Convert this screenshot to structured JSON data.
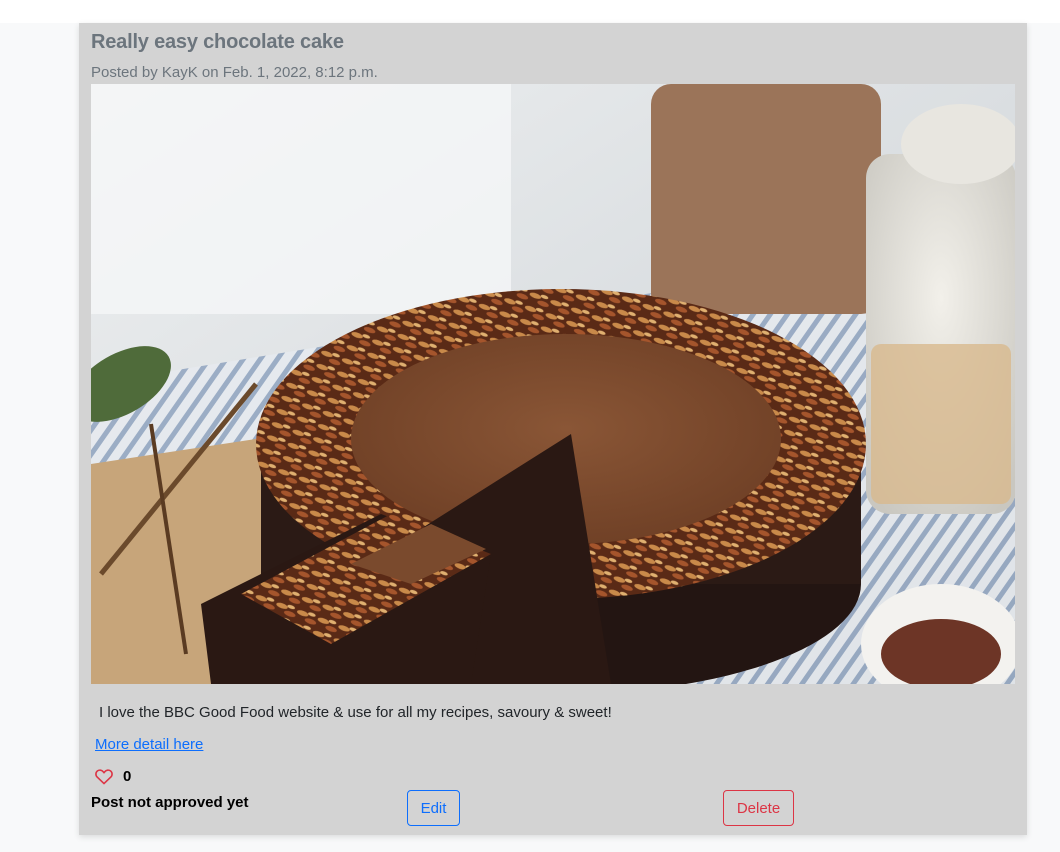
{
  "post": {
    "title": "Really easy chocolate cake",
    "meta": "Posted by KayK on Feb. 1, 2022, 8:12 p.m.",
    "image_alt": "Chocolate cake with almond topping",
    "excerpt": "I love the BBC Good Food website & use for all my recipes, savoury & sweet!",
    "more_link_label": "More detail here",
    "like_count": "0",
    "approval_status": "Post not approved yet"
  },
  "actions": {
    "edit_label": "Edit",
    "delete_label": "Delete"
  },
  "icons": {
    "like": "heart-outline-icon"
  },
  "colors": {
    "card_bg": "#d3d3d3",
    "muted_text": "#6c757d",
    "link": "#0d6efd",
    "danger": "#dc3545",
    "heart": "#dc3545"
  }
}
